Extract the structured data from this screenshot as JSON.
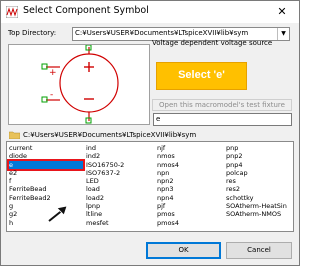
{
  "window": {
    "title": "Select Component Symbol",
    "close_glyph": "✕"
  },
  "top_directory": {
    "label": "Top Directory:",
    "value": "C:¥Users¥USER¥Documents¥LTspiceXVII¥lib¥sym"
  },
  "description": "Voltage dependent voltage source",
  "callout": {
    "text": "Select 'e'",
    "color": "#ffc000"
  },
  "test_fixture_button": "Open this macromodel's test fixture",
  "search": {
    "value": "e"
  },
  "path": "C:¥Users¥USER¥Documents¥LTspiceXVII¥lib¥sym",
  "columns": [
    [
      "current",
      "diode",
      "e",
      "e2",
      "f",
      "FerriteBead",
      "FerriteBead2",
      "g",
      "g2",
      "h"
    ],
    [
      "ind",
      "ind2",
      "ISO16750-2",
      "ISO7637-2",
      "LED",
      "load",
      "load2",
      "lpnp",
      "ltline",
      "mesfet"
    ],
    [
      "njf",
      "nmos",
      "nmos4",
      "npn",
      "npn2",
      "npn3",
      "npn4",
      "pjf",
      "pmos",
      "pmos4"
    ],
    [
      "pnp",
      "pnp2",
      "pnp4",
      "polcap",
      "res",
      "res2",
      "schottky",
      "SOAtherm-HeatSin",
      "SOAtherm-NMOS",
      ""
    ]
  ],
  "selected": "e",
  "buttons": {
    "ok": "OK",
    "cancel": "Cancel"
  },
  "colors": {
    "symbol_stroke": "#d00000",
    "pin": "#00a000",
    "selection": "#0078d7",
    "highlight_border": "#e8151b"
  }
}
